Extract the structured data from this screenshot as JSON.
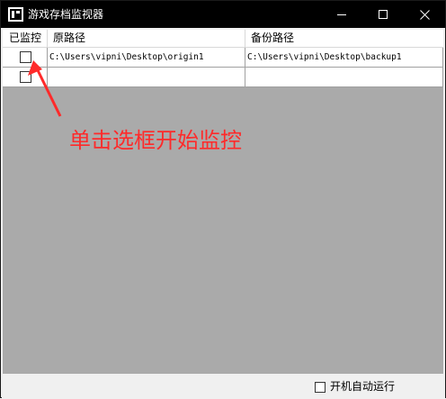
{
  "window": {
    "title": "游戏存档监视器",
    "icon": "app-icon",
    "controls": [
      "minimize-icon",
      "maximize-icon",
      "close-icon"
    ]
  },
  "table": {
    "columns": [
      "已监控",
      "原路径",
      "备份路径"
    ],
    "rows": [
      {
        "checked": false,
        "original_path": "C:\\Users\\vipni\\Desktop\\origin1",
        "backup_path": "C:\\Users\\vipni\\Desktop\\backup1"
      },
      {
        "checked": false,
        "original_path": "",
        "backup_path": ""
      }
    ]
  },
  "annotation": {
    "text": "单击选框开始监控",
    "color": "#ff2a2a"
  },
  "footer": {
    "autostart_label": "开机自动运行",
    "autostart_checked": false
  }
}
